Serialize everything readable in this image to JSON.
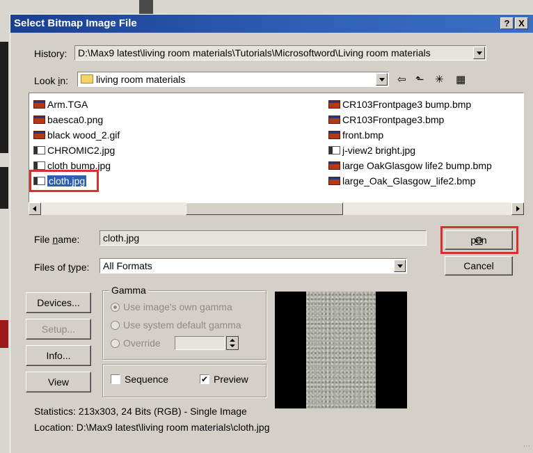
{
  "dialog": {
    "title": "Select Bitmap Image File",
    "help_btn": "?",
    "close_btn": "X"
  },
  "history": {
    "label": "History:",
    "value": "D:\\Max9 latest\\living room materials\\Tutorials\\Microsoftword\\Living room materials"
  },
  "lookin": {
    "label_pre": "Look ",
    "label_key": "i",
    "label_post": "n:",
    "value": "living room materials"
  },
  "toolbar": {
    "back_icon": "⇦",
    "up_icon": "⬑",
    "newfolder_icon": "✳",
    "views_icon": "▦"
  },
  "files": {
    "left": [
      "Arm.TGA",
      "baesca0.png",
      "black wood_2.gif",
      "CHROMIC2.jpg",
      "cloth bump.jpg",
      "cloth.jpg"
    ],
    "right": [
      "CR103Frontpage3 bump.bmp",
      "CR103Frontpage3.bmp",
      "front.bmp",
      "j-view2 bright.jpg",
      "large OakGlasgow life2 bump.bmp",
      "large_Oak_Glasgow_life2.bmp"
    ],
    "selected": "cloth.jpg"
  },
  "filename": {
    "label_pre": "File ",
    "label_key": "n",
    "label_post": "ame:",
    "value": "cloth.jpg"
  },
  "filetype": {
    "label_pre": "Files of ",
    "label_key": "t",
    "label_post": "ype:",
    "value": "All Formats"
  },
  "buttons": {
    "open_key": "O",
    "open_rest": "pen",
    "cancel": "Cancel",
    "devices": "Devices...",
    "setup": "Setup...",
    "info": "Info...",
    "view": "View"
  },
  "gamma": {
    "title": "Gamma",
    "opt1": "Use image's own gamma",
    "opt2": "Use system default gamma",
    "opt3": "Override"
  },
  "options": {
    "sequence": "Sequence",
    "preview": "Preview",
    "check_mark": "✔"
  },
  "stats": {
    "statistics": "Statistics:  213x303, 24 Bits (RGB) - Single Image",
    "location": "Location:  D:\\Max9 latest\\living room materials\\cloth.jpg"
  },
  "colors": {
    "highlight": "#d8302c",
    "selection": "#2d5fb0",
    "titlebar": "#1a3f8f"
  }
}
